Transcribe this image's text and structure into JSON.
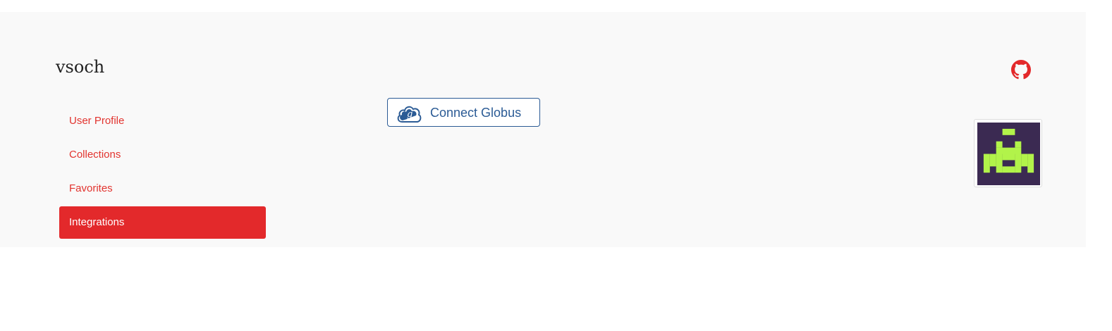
{
  "profile": {
    "username": "vsoch"
  },
  "nav": {
    "items": [
      {
        "label": "User Profile",
        "active": false
      },
      {
        "label": "Collections",
        "active": false
      },
      {
        "label": "Favorites",
        "active": false
      },
      {
        "label": "Integrations",
        "active": true
      }
    ]
  },
  "integrations": {
    "connect_globus_label": "Connect Globus"
  },
  "icons": {
    "github": "github-icon",
    "globus": "globus-cloud-icon",
    "avatar": "space-invader-avatar"
  },
  "colors": {
    "accent": "#e3292b",
    "link": "#e2342f",
    "globus_blue": "#2b5b95",
    "avatar_bg": "#3b2a52",
    "avatar_fg": "#b2f34a",
    "panel_bg": "#f9f9f9"
  }
}
